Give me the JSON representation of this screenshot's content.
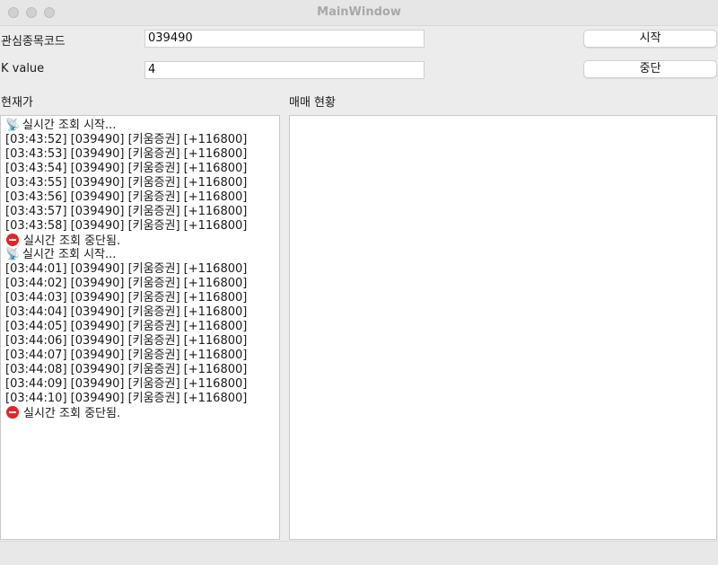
{
  "window": {
    "title": "MainWindow"
  },
  "form": {
    "code_label": "관심종목코드",
    "code_value": "039490",
    "k_label": "K value",
    "k_value": "4",
    "start_button": "시작",
    "stop_button": "중단"
  },
  "panels": {
    "current_price_label": "현재가",
    "trade_status_label": "매매 현황"
  },
  "log": [
    {
      "icon": "satellite-icon",
      "text": "실시간 조회 시작..."
    },
    {
      "text": "[03:43:52] [039490] [키움증권] [+116800]"
    },
    {
      "text": "[03:43:53] [039490] [키움증권] [+116800]"
    },
    {
      "text": "[03:43:54] [039490] [키움증권] [+116800]"
    },
    {
      "text": "[03:43:55] [039490] [키움증권] [+116800]"
    },
    {
      "text": "[03:43:56] [039490] [키움증권] [+116800]"
    },
    {
      "text": "[03:43:57] [039490] [키움증권] [+116800]"
    },
    {
      "text": "[03:43:58] [039490] [키움증권] [+116800]"
    },
    {
      "icon": "stop-icon",
      "text": "실시간 조회 중단됨."
    },
    {
      "icon": "satellite-icon",
      "text": "실시간 조회 시작..."
    },
    {
      "text": "[03:44:01] [039490] [키움증권] [+116800]"
    },
    {
      "text": "[03:44:02] [039490] [키움증권] [+116800]"
    },
    {
      "text": "[03:44:03] [039490] [키움증권] [+116800]"
    },
    {
      "text": "[03:44:04] [039490] [키움증권] [+116800]"
    },
    {
      "text": "[03:44:05] [039490] [키움증권] [+116800]"
    },
    {
      "text": "[03:44:06] [039490] [키움증권] [+116800]"
    },
    {
      "text": "[03:44:07] [039490] [키움증권] [+116800]"
    },
    {
      "text": "[03:44:08] [039490] [키움증권] [+116800]"
    },
    {
      "text": "[03:44:09] [039490] [키움증권] [+116800]"
    },
    {
      "text": "[03:44:10] [039490] [키움증권] [+116800]"
    },
    {
      "icon": "stop-icon",
      "text": "실시간 조회 중단됨."
    }
  ]
}
